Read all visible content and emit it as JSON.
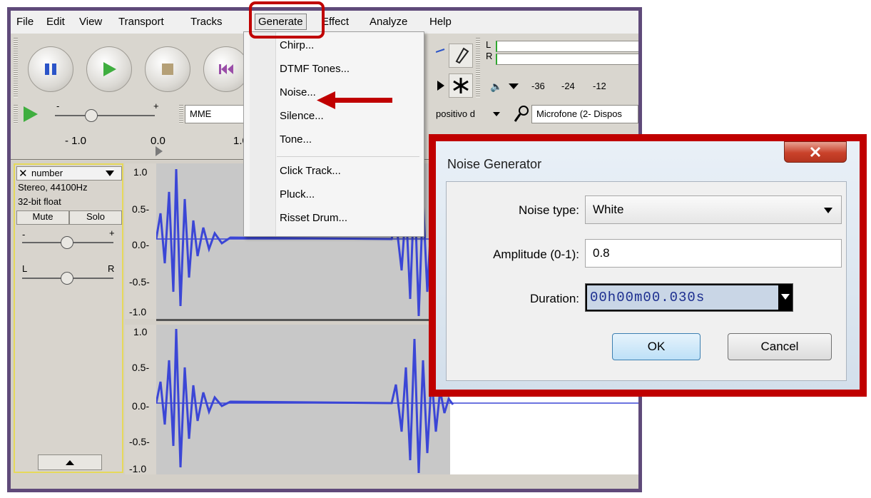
{
  "menubar": {
    "items": [
      "File",
      "Edit",
      "View",
      "Transport",
      "Tracks",
      "Generate",
      "Effect",
      "Analyze",
      "Help"
    ]
  },
  "generate_menu": {
    "items": [
      "Chirp...",
      "DTMF Tones...",
      "Noise...",
      "Silence...",
      "Tone...",
      "Click Track...",
      "Pluck...",
      "Risset Drum..."
    ]
  },
  "toolbar": {
    "host": "MME",
    "playback_device": "positivo d",
    "recording_device": "Microfone (2- Dispos",
    "meter_channel_l": "L",
    "meter_channel_r": "R",
    "meter_ticks": [
      "-36",
      "-24",
      "-12"
    ],
    "slider_minus": "-",
    "slider_plus": "+"
  },
  "ruler": {
    "ticks": [
      "- 1.0",
      "0.0",
      "1.0"
    ]
  },
  "track": {
    "name": "number",
    "format": "Stereo, 44100Hz",
    "bit_depth": "32-bit float",
    "mute_label": "Mute",
    "solo_label": "Solo",
    "gain_minus": "-",
    "gain_plus": "+",
    "pan_left": "L",
    "pan_right": "R",
    "scale_labels": [
      "1.0",
      "0.5-",
      "0.0-",
      "-0.5-",
      "-1.0"
    ]
  },
  "dialog": {
    "title": "Noise Generator",
    "noise_type_label": "Noise type:",
    "noise_type_value": "White",
    "amplitude_label": "Amplitude (0-1):",
    "amplitude_value": "0.8",
    "duration_label": "Duration:",
    "duration_value": "00h00m00.030s",
    "ok_label": "OK",
    "cancel_label": "Cancel"
  },
  "colors": {
    "highlight": "#c00000",
    "waveform": "#3b46d6",
    "selection": "#c8c8c8",
    "frame": "#5f4a7a"
  }
}
